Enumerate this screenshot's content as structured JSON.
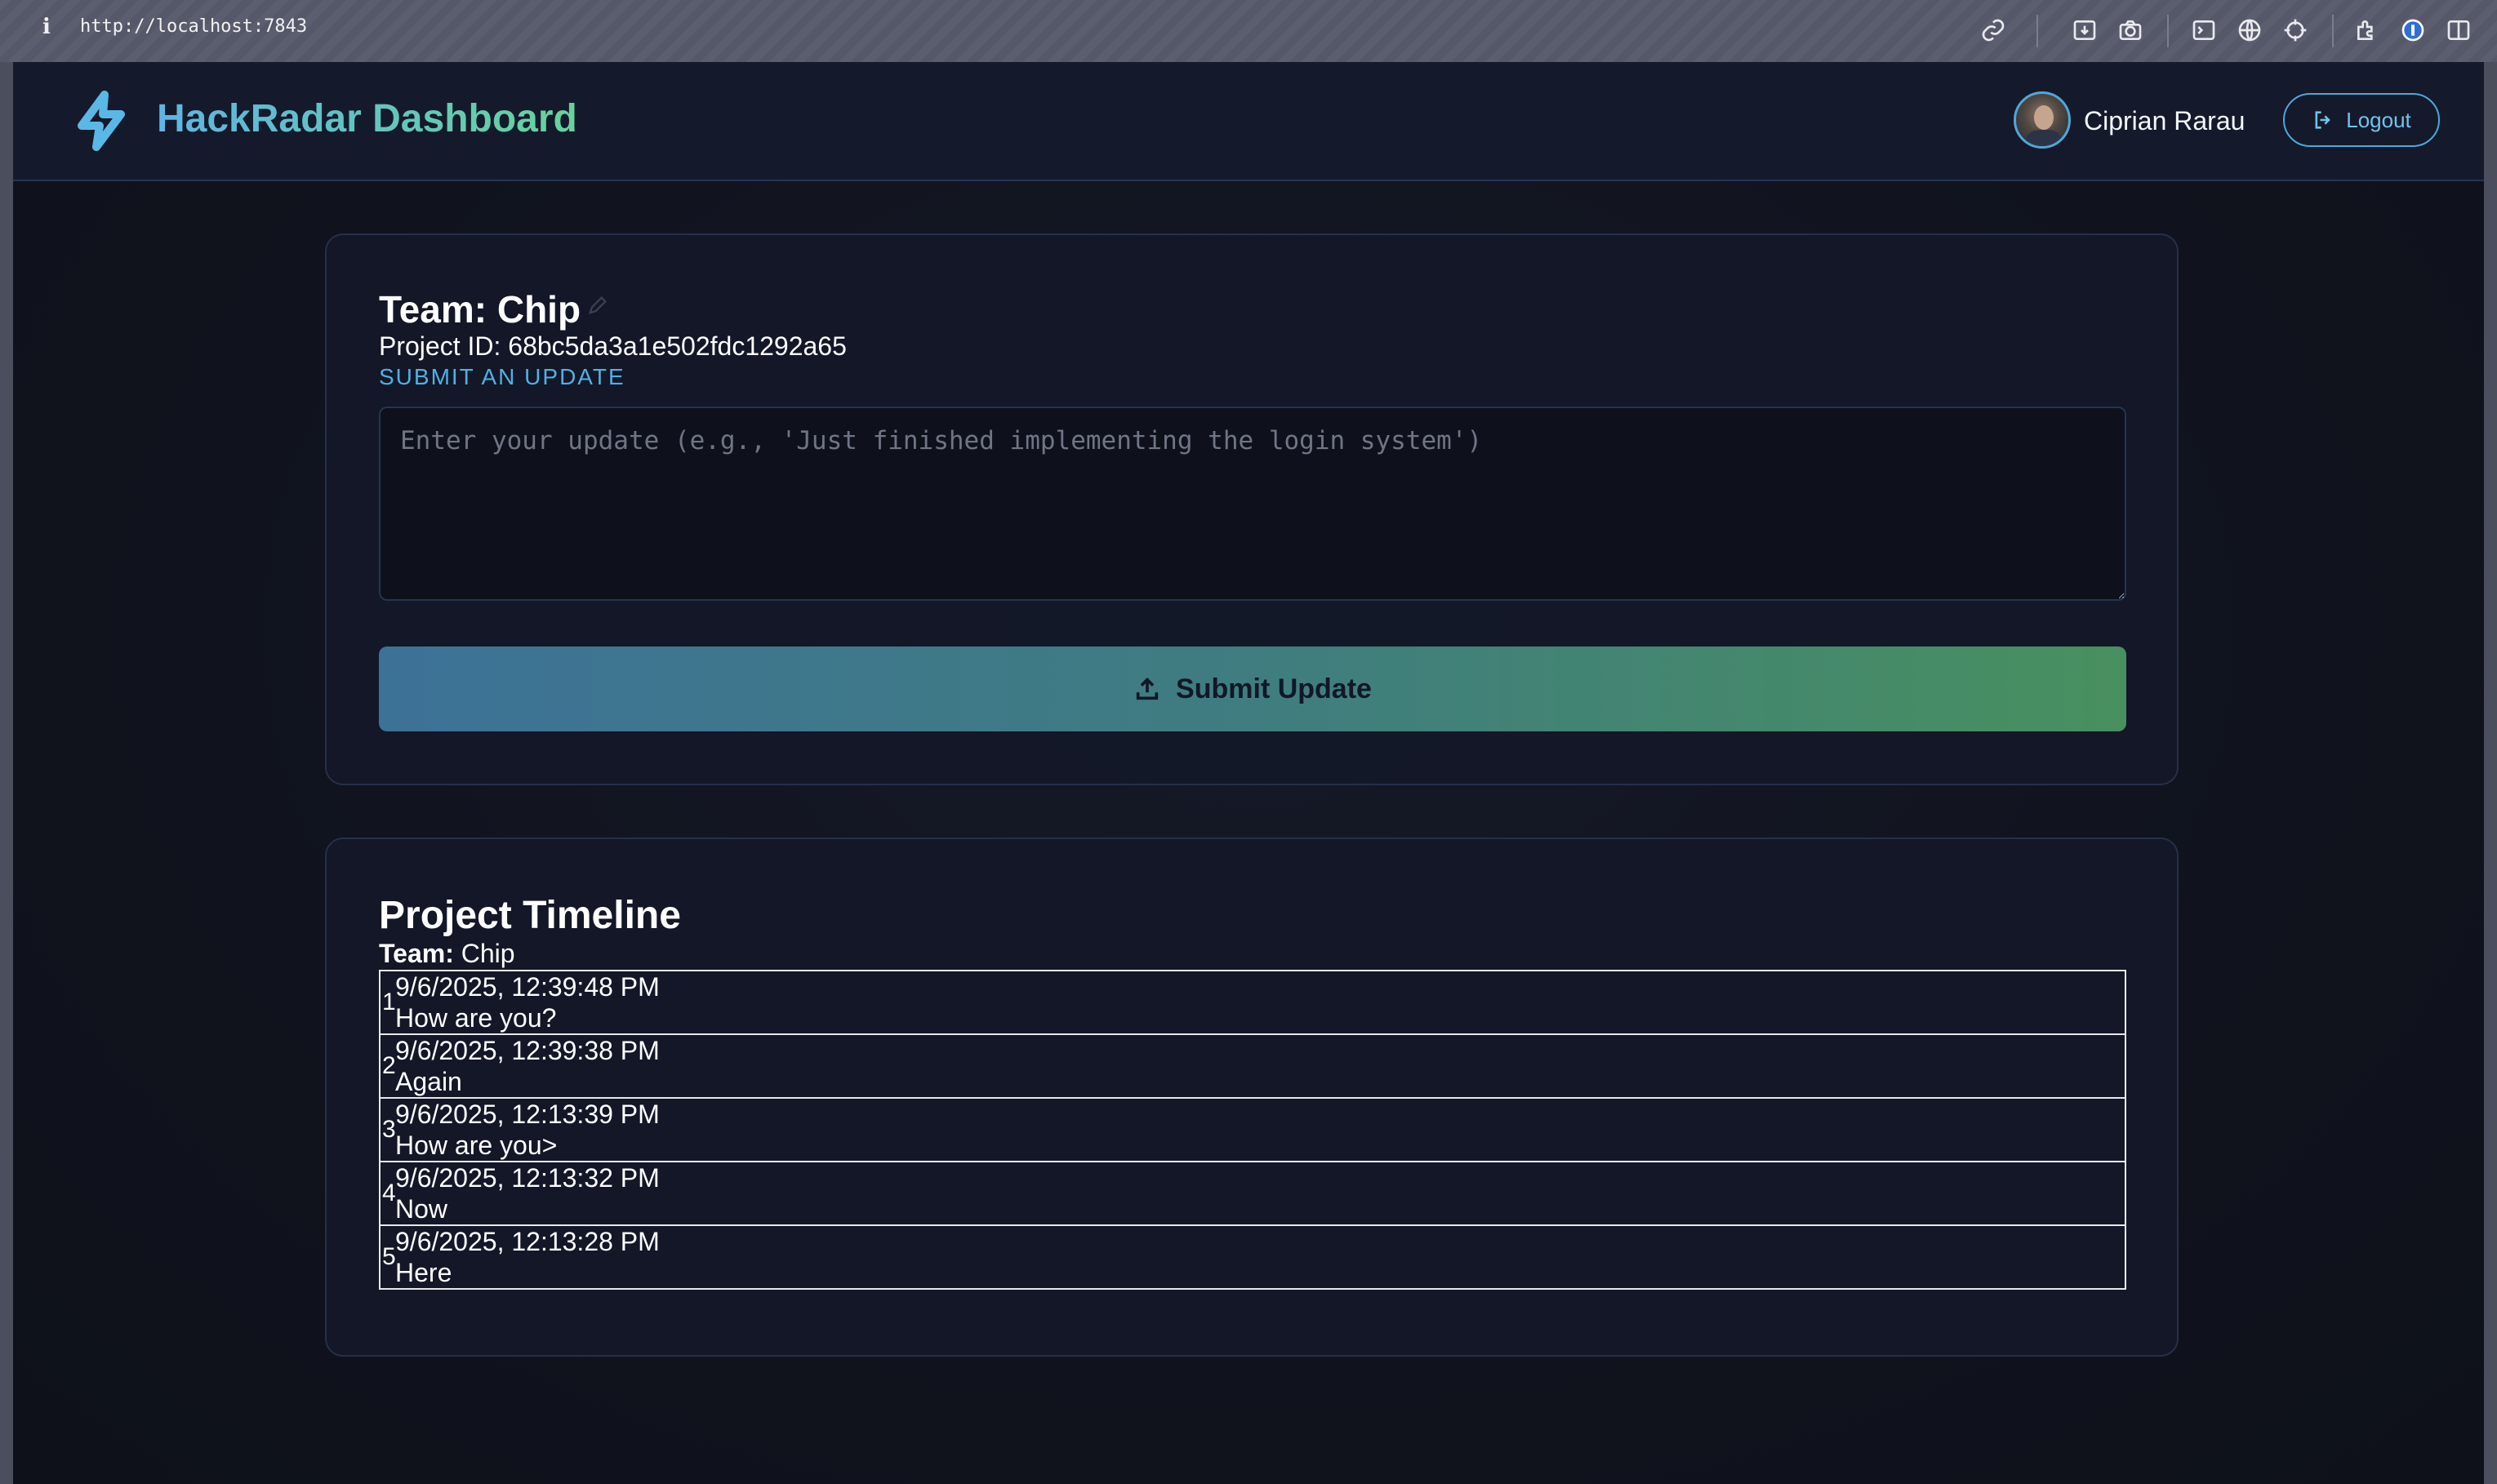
{
  "browser": {
    "url": "http://localhost:7843",
    "info_glyph": "i",
    "toolbar_icons": [
      "link-icon",
      "download-icon",
      "camera-icon",
      "terminal-icon",
      "globe-icon",
      "crosshair-icon",
      "extensions-icon",
      "password-manager-icon",
      "sidebar-icon"
    ]
  },
  "header": {
    "logo_icon": "lightning-bolt-icon",
    "title": "HackRadar Dashboard",
    "user_name": "Ciprian Rarau",
    "logout_label": "Logout"
  },
  "update_card": {
    "team_title": "Team: Chip",
    "project_id": "Project ID: 68bc5da3a1e502fdc1292a65",
    "section_label": "SUBMIT AN UPDATE",
    "input_placeholder": "Enter your update (e.g., 'Just finished implementing the login system')",
    "input_value": "",
    "submit_label": "Submit Update"
  },
  "timeline_card": {
    "title": "Project Timeline",
    "team_label": "Team:",
    "team_name": "Chip",
    "entries": [
      {
        "index": "1",
        "timestamp": "9/6/2025, 12:39:48 PM",
        "message": "How are you?"
      },
      {
        "index": "2",
        "timestamp": "9/6/2025, 12:39:38 PM",
        "message": "Again"
      },
      {
        "index": "3",
        "timestamp": "9/6/2025, 12:13:39 PM",
        "message": "How are you>"
      },
      {
        "index": "4",
        "timestamp": "9/6/2025, 12:13:32 PM",
        "message": "Now"
      },
      {
        "index": "5",
        "timestamp": "9/6/2025, 12:13:28 PM",
        "message": "Here"
      }
    ]
  },
  "colors": {
    "accent_blue": "#4fb0e6",
    "accent_green": "#67d39c",
    "background": "#10131d",
    "card_border": "#253048"
  }
}
